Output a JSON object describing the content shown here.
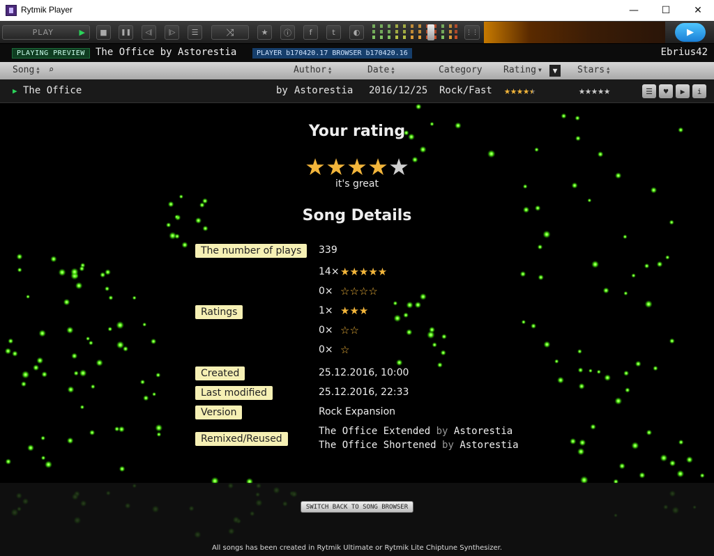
{
  "window": {
    "title": "Rytmik Player",
    "minimize": "—",
    "maximize": "☐",
    "close": "✕"
  },
  "toolbar": {
    "play_label": "PLAY",
    "stop": "■",
    "pause": "❚❚",
    "prev": "◁|",
    "next": "|▷",
    "list": "☰",
    "shuffle": "⤨",
    "star": "★",
    "info": "ⓘ",
    "facebook": "f",
    "twitter": "t",
    "moon": "◐"
  },
  "status": {
    "badge": "PLAYING PREVIEW",
    "now_playing": "The Office by Astorestia",
    "version": "PLAYER b170420.17 BROWSER b170420.16",
    "user": "Ebrius42"
  },
  "columns": {
    "song": "Song",
    "author": "Author",
    "date": "Date",
    "category": "Category",
    "rating": "Rating",
    "stars": "Stars",
    "filter": "▼"
  },
  "song_row": {
    "title": "The Office",
    "by": "by",
    "author": "Astorestia",
    "date": "2016/12/25",
    "category": "Rock/Fast",
    "rating_stars": "★★★★",
    "rating_half": "★",
    "user_stars": "★★★★★"
  },
  "details": {
    "your_rating_heading": "Your rating",
    "your_rating": 4,
    "rating_word": "it's great",
    "heading": "Song Details",
    "plays_label": "The number of plays",
    "plays": "339",
    "ratings_label": "Ratings",
    "ratings": [
      {
        "count": "14×",
        "stars": "★★★★★"
      },
      {
        "count": "0×",
        "stars": "☆☆☆☆"
      },
      {
        "count": "1×",
        "stars": "★★★"
      },
      {
        "count": "0×",
        "stars": "☆☆"
      },
      {
        "count": "0×",
        "stars": "☆"
      }
    ],
    "created_label": "Created",
    "created": "25.12.2016, 10:00",
    "modified_label": "Last modified",
    "modified": "25.12.2016, 22:33",
    "version_label": "Version",
    "version": "Rock Expansion",
    "remixed_label": "Remixed/Reused",
    "remixes": [
      {
        "title": "The Office Extended",
        "by": "by",
        "author": "Astorestia"
      },
      {
        "title": "The Office Shortened",
        "by": "by",
        "author": "Astorestia"
      }
    ]
  },
  "footer": {
    "switch": "SWITCH BACK TO SONG BROWSER",
    "note": "All songs has been created in Rytmik Ultimate or Rytmik Lite Chiptune Synthesizer."
  },
  "colors": {
    "accent_green": "#5cff1a",
    "star": "#f2b53b",
    "label_bg": "#f6f0b4"
  }
}
